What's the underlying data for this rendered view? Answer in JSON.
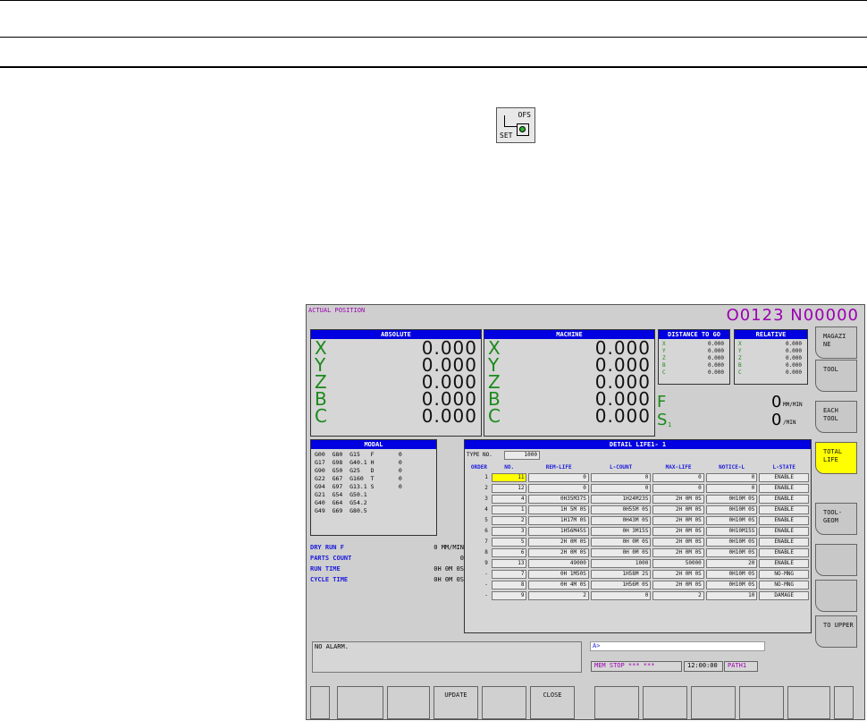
{
  "key_icon": {
    "name": "offset-setting-key-icon",
    "label_top": "OFS",
    "label_bottom": "SET"
  },
  "screen": {
    "title": "ACTUAL POSITION",
    "program": "O0123 N00000",
    "absolute": {
      "header": "ABSOLUTE",
      "rows": [
        {
          "axis": "X",
          "value": "0.000"
        },
        {
          "axis": "Y",
          "value": "0.000"
        },
        {
          "axis": "Z",
          "value": "0.000"
        },
        {
          "axis": "B",
          "value": "0.000"
        },
        {
          "axis": "C",
          "value": "0.000"
        }
      ]
    },
    "machine": {
      "header": "MACHINE",
      "rows": [
        {
          "axis": "X",
          "value": "0.000"
        },
        {
          "axis": "Y",
          "value": "0.000"
        },
        {
          "axis": "Z",
          "value": "0.000"
        },
        {
          "axis": "B",
          "value": "0.000"
        },
        {
          "axis": "C",
          "value": "0.000"
        }
      ]
    },
    "distance": {
      "header": "DISTANCE TO GO",
      "rows": [
        {
          "axis": "X",
          "value": "0.000"
        },
        {
          "axis": "Y",
          "value": "0.000"
        },
        {
          "axis": "Z",
          "value": "0.000"
        },
        {
          "axis": "B",
          "value": "0.000"
        },
        {
          "axis": "C",
          "value": "0.000"
        }
      ]
    },
    "relative": {
      "header": "RELATIVE",
      "rows": [
        {
          "axis": "X",
          "value": "0.000"
        },
        {
          "axis": "Y",
          "value": "0.000"
        },
        {
          "axis": "Z",
          "value": "0.000"
        },
        {
          "axis": "B",
          "value": "0.000"
        },
        {
          "axis": "C",
          "value": "0.000"
        }
      ]
    },
    "feed": {
      "label": "F",
      "value": "0",
      "unit": "MM/MIN"
    },
    "spindle": {
      "label": "S",
      "sub": "1",
      "value": "0",
      "unit": "/MIN"
    },
    "modal": {
      "header": "MODAL",
      "lines": [
        "G00  G80  G15   F       0",
        "G17  G98  G40.1 H       0",
        "G90  G50  G25   D       0",
        "G22  G67  G160  T       0",
        "G94  G97  G13.1 S       0",
        "G21  G54  G50.1",
        "G40  G64  G54.2",
        "G49  G69  G80.5"
      ]
    },
    "status": [
      {
        "label": "DRY RUN F",
        "value": "0 MM/MIN"
      },
      {
        "label": "PARTS COUNT",
        "value": "0"
      },
      {
        "label": "RUN TIME",
        "value": "0H 0M 0S"
      },
      {
        "label": "CYCLE TIME",
        "value": "0H 0M 0S"
      }
    ],
    "detail": {
      "header": "DETAIL LIFE1-  1",
      "type_label": "TYPE NO.",
      "type_value": "1000",
      "columns": [
        "ORDER",
        "NO.",
        "REM-LIFE",
        "L-COUNT",
        "MAX-LIFE",
        "NOTICE-L",
        "L-STATE"
      ],
      "rows": [
        [
          "1",
          "11",
          "0",
          "0",
          "0",
          "0",
          "ENABLE"
        ],
        [
          "2",
          "12",
          "0",
          "0",
          "0",
          "0",
          "ENABLE"
        ],
        [
          "3",
          "4",
          "0H35M37S",
          "1H24M23S",
          "2H 0M 0S",
          "0H10M 0S",
          "ENABLE"
        ],
        [
          "4",
          "1",
          "1H 5M 0S",
          "0H55M 0S",
          "2H 0M 0S",
          "0H10M 0S",
          "ENABLE"
        ],
        [
          "5",
          "2",
          "1H17M 0S",
          "0H43M 0S",
          "2H 0M 0S",
          "0H10M 0S",
          "ENABLE"
        ],
        [
          "6",
          "3",
          "1H56M45S",
          "0H 3M15S",
          "2H 0M 0S",
          "0H10M15S",
          "ENABLE"
        ],
        [
          "7",
          "5",
          "2H 0M 0S",
          "0H 0M 0S",
          "2H 0M 0S",
          "0H10M 0S",
          "ENABLE"
        ],
        [
          "8",
          "6",
          "2H 0M 0S",
          "0H 0M 0S",
          "2H 0M 0S",
          "0H10M 0S",
          "ENABLE"
        ],
        [
          "9",
          "13",
          "49000",
          "1000",
          "50000",
          "20",
          "ENABLE"
        ],
        [
          "-",
          "7",
          "0H 1M50S",
          "1H58M 2S",
          "2H 0M 0S",
          "0H10M 0S",
          "NO-MNG"
        ],
        [
          "-",
          "8",
          "0H 4M 0S",
          "1H56M 0S",
          "2H 0M 0S",
          "0H10M 0S",
          "NO-MNG"
        ],
        [
          "-",
          "9",
          "2",
          "0",
          "2",
          "10",
          "DAMAGE"
        ]
      ]
    },
    "alarm": "NO ALARM.",
    "input_prompt": "A>",
    "mode_status": "MEM  STOP *** ***",
    "clock": "12:00:00",
    "path": "PATH1",
    "soft_keys": [
      {
        "label": "MAGAZI NE",
        "active": false
      },
      {
        "label": "TOOL",
        "active": false
      },
      {
        "label": "EACH TOOL",
        "active": false
      },
      {
        "label": "TOTAL LIFE",
        "active": true
      },
      {
        "label": "TOOL- GEOM",
        "active": false
      },
      {
        "label": "",
        "active": false
      },
      {
        "label": "",
        "active": false
      },
      {
        "label": "TO UPPER",
        "active": false
      }
    ],
    "bottom_keys": [
      "",
      "",
      "",
      "UPDATE",
      "",
      "CLOSE",
      "",
      "",
      "",
      "",
      "",
      ""
    ]
  }
}
